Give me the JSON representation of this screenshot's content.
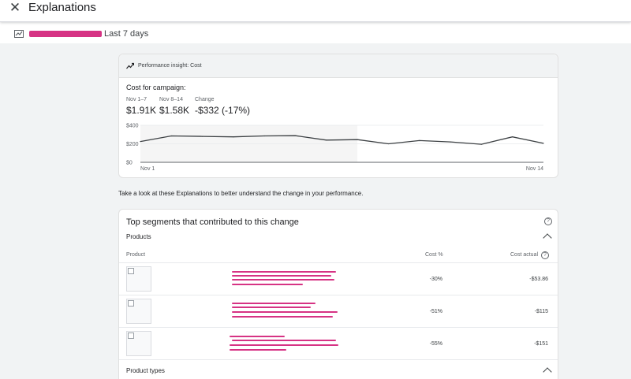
{
  "header": {
    "title": "Explanations",
    "close_icon": "close-icon"
  },
  "subheader": {
    "range": "Last 7 days",
    "icon": "trend-chart-icon"
  },
  "insight": {
    "title": "Performance insight: Cost",
    "metric_title": "Cost for campaign:",
    "stats": [
      {
        "label": "Nov 1–7",
        "value": "$1.91K"
      },
      {
        "label": "Nov 8–14",
        "value": "$1.58K"
      },
      {
        "label": "Change",
        "value": "-$332 (-17%)"
      }
    ]
  },
  "chart_data": {
    "type": "line",
    "x": [
      "Nov 1",
      "Nov 2",
      "Nov 3",
      "Nov 4",
      "Nov 5",
      "Nov 6",
      "Nov 7",
      "Nov 8",
      "Nov 9",
      "Nov 10",
      "Nov 11",
      "Nov 12",
      "Nov 13",
      "Nov 14"
    ],
    "series": [
      {
        "values": [
          225,
          285,
          280,
          275,
          285,
          288,
          240,
          245,
          200,
          235,
          220,
          195,
          275,
          205
        ]
      }
    ],
    "ylim": [
      0,
      400
    ],
    "yticks": [
      "$400",
      "$200",
      "$0"
    ],
    "xtick_labels": [
      "Nov 1",
      "Nov 14"
    ],
    "shaded_period": [
      "Nov 1",
      "Nov 7"
    ],
    "line_color": "#3c4043"
  },
  "explain_text": "Take a look at these Explanations to better understand the change in your performance.",
  "segments": {
    "title": "Top segments that contributed to this change",
    "products_label": "Products",
    "columns": {
      "product": "Product",
      "cost_pct": "Cost %",
      "cost_actual": "Cost actual"
    },
    "rows": [
      {
        "cost_pct": "-30%",
        "cost_actual": "-$53.86"
      },
      {
        "cost_pct": "-51%",
        "cost_actual": "-$115"
      },
      {
        "cost_pct": "-55%",
        "cost_actual": "-$151"
      }
    ],
    "product_types_label": "Product types"
  },
  "colors": {
    "redaction": "#d63384",
    "accent_text": "#202124"
  }
}
